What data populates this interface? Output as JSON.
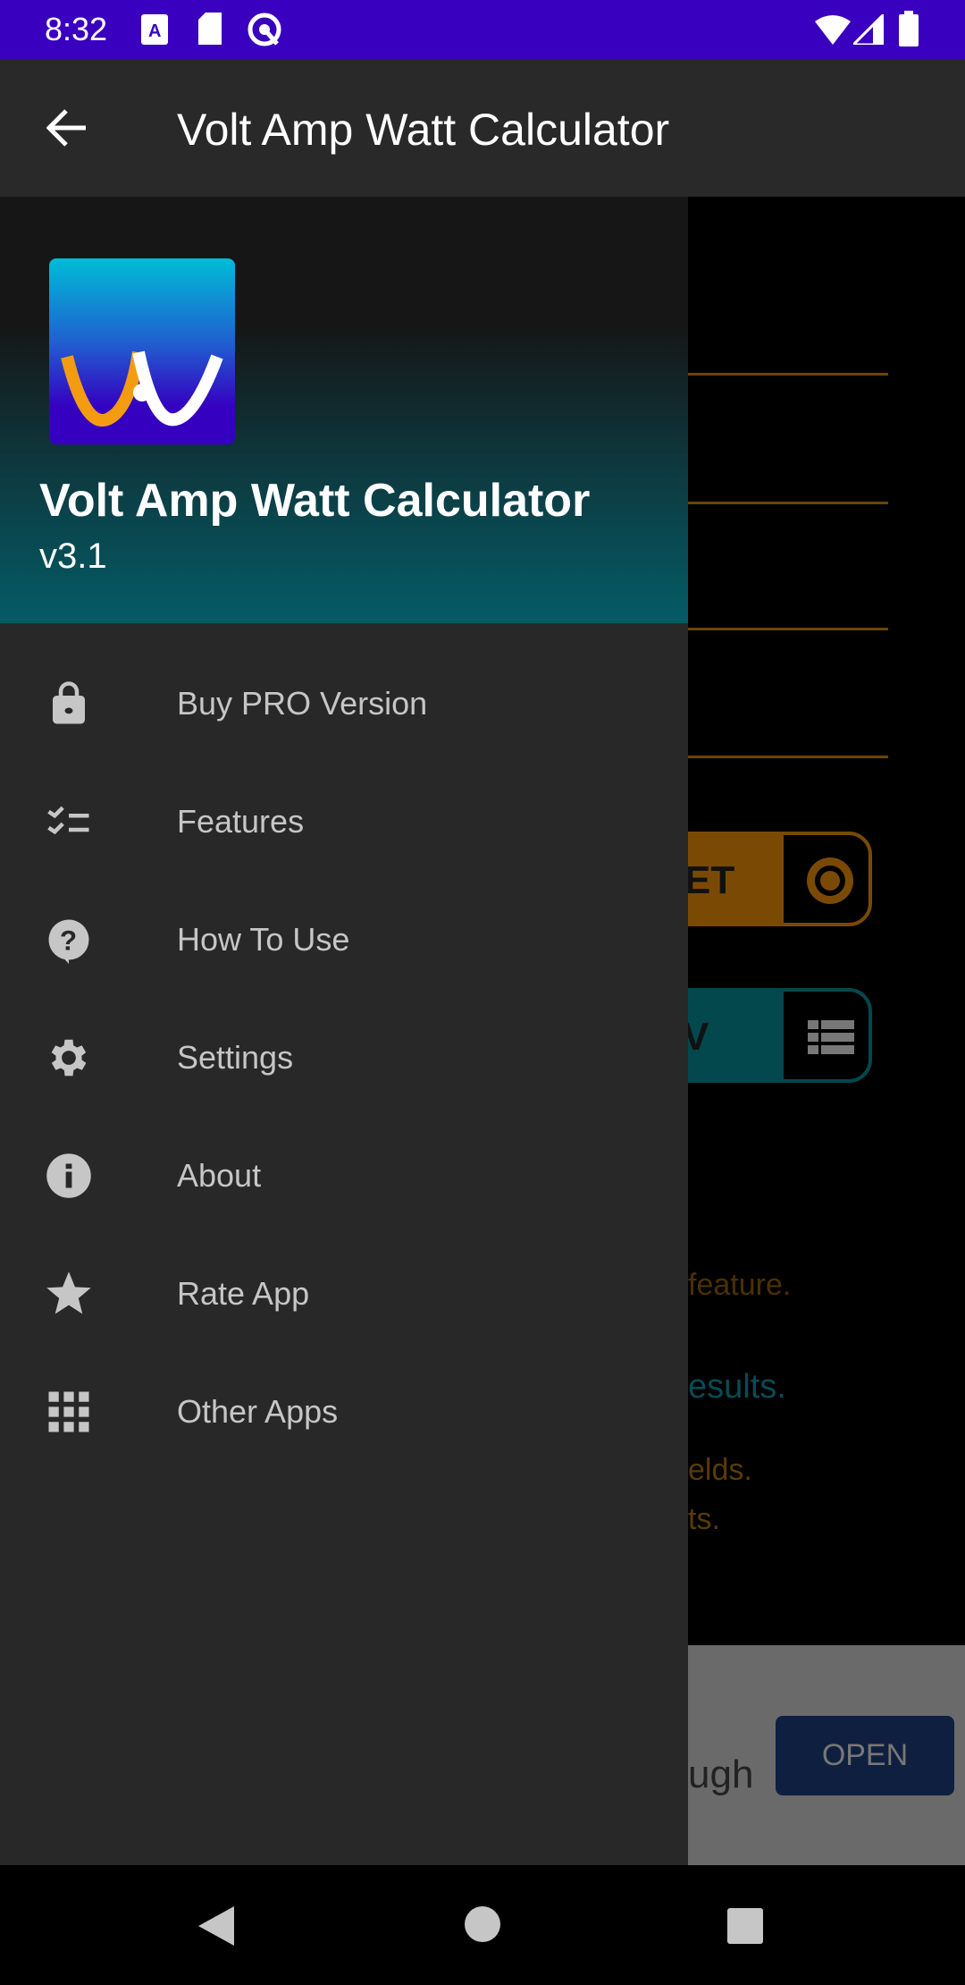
{
  "status_bar": {
    "time": "8:32",
    "icons": [
      "font-icon",
      "sd-card-icon",
      "vpn-icon",
      "wifi-icon",
      "signal-icon",
      "battery-icon"
    ]
  },
  "app_bar": {
    "title": "Volt Amp Watt Calculator",
    "back_icon": "arrow-back-icon"
  },
  "drawer": {
    "header": {
      "app_name": "Volt Amp Watt Calculator",
      "version": "v3.1"
    },
    "items": [
      {
        "label": "Buy PRO Version",
        "icon": "lock-icon"
      },
      {
        "label": "Features",
        "icon": "checklist-icon"
      },
      {
        "label": "How To Use",
        "icon": "help-icon"
      },
      {
        "label": "Settings",
        "icon": "gear-icon"
      },
      {
        "label": "About",
        "icon": "info-icon"
      },
      {
        "label": "Rate App",
        "icon": "star-icon"
      },
      {
        "label": "Other Apps",
        "icon": "apps-grid-icon"
      }
    ]
  },
  "background": {
    "reset_label_fragment": "ET",
    "view_label_fragment": "V",
    "hint1": "feature.",
    "hint2": "esults.",
    "hint3": "elds.",
    "hint4": "ts.",
    "ad_text_fragment": "ugh",
    "ad_button": "OPEN"
  },
  "colors": {
    "status": "#3a00bf",
    "accent_orange": "#7a4a05",
    "accent_teal": "#03484d"
  }
}
